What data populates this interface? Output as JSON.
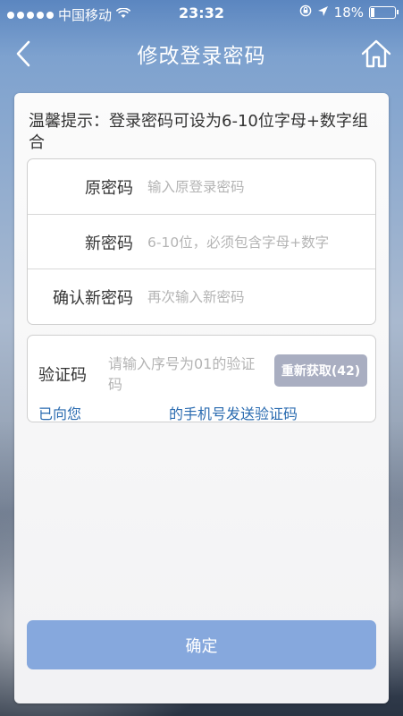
{
  "status_bar": {
    "carrier": "中国移动",
    "time": "23:32",
    "battery": "18%",
    "battery_fraction": 0.18
  },
  "nav": {
    "title": "修改登录密码",
    "back_icon": "chevron-left-icon",
    "home_icon": "home-icon"
  },
  "tip": "温馨提示：登录密码可设为6-10位字母+数字组合",
  "form": {
    "old_password": {
      "label": "原密码",
      "placeholder": "输入原登录密码"
    },
    "new_password": {
      "label": "新密码",
      "placeholder": "6-10位，必须包含字母+数字"
    },
    "confirm_password": {
      "label": "确认新密码",
      "placeholder": "再次输入新密码"
    }
  },
  "verify": {
    "label": "验证码",
    "placeholder": "请输入序号为01的验证码",
    "resend_label": "重新获取(42)",
    "sent_prefix": "已向您",
    "sent_suffix": "的手机号发送验证码"
  },
  "confirm_label": "确定",
  "colors": {
    "confirm_button": "#86a8dd",
    "resend_button": "#a9aec1",
    "link_text": "#2a6bb0"
  }
}
